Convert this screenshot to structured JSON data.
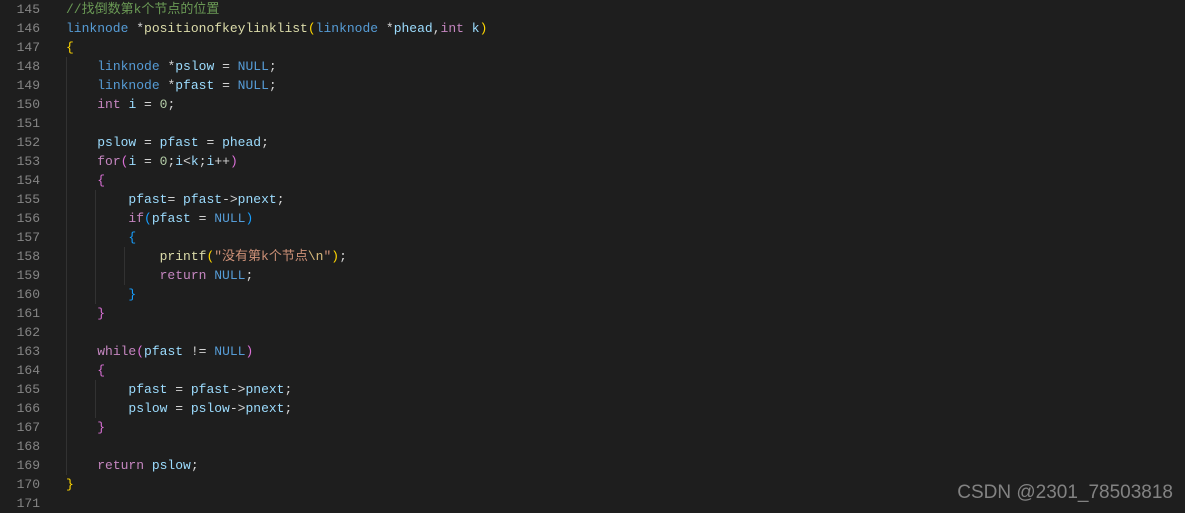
{
  "watermark": "CSDN @2301_78503818",
  "startLine": 145,
  "lines": [
    {
      "n": 145,
      "tokens": [
        {
          "t": "//找倒数第k个节点的位置",
          "c": "tok-comment"
        }
      ]
    },
    {
      "n": 146,
      "tokens": [
        {
          "t": "linknode ",
          "c": "tok-type"
        },
        {
          "t": "*",
          "c": "tok-op"
        },
        {
          "t": "positionofkeylinklist",
          "c": "tok-func"
        },
        {
          "t": "(",
          "c": "tok-brace-yellow"
        },
        {
          "t": "linknode ",
          "c": "tok-type"
        },
        {
          "t": "*",
          "c": "tok-op"
        },
        {
          "t": "phead",
          "c": "tok-param"
        },
        {
          "t": ",",
          "c": "tok-punct"
        },
        {
          "t": "int ",
          "c": "tok-keyword"
        },
        {
          "t": "k",
          "c": "tok-param"
        },
        {
          "t": ")",
          "c": "tok-brace-yellow"
        }
      ]
    },
    {
      "n": 147,
      "tokens": [
        {
          "t": "{",
          "c": "tok-brace-yellow"
        }
      ]
    },
    {
      "n": 148,
      "tokens": [
        {
          "t": "    ",
          "c": ""
        },
        {
          "t": "linknode ",
          "c": "tok-type"
        },
        {
          "t": "*",
          "c": "tok-op"
        },
        {
          "t": "pslow",
          "c": "tok-var"
        },
        {
          "t": " = ",
          "c": "tok-op"
        },
        {
          "t": "NULL",
          "c": "tok-const"
        },
        {
          "t": ";",
          "c": "tok-punct"
        }
      ]
    },
    {
      "n": 149,
      "tokens": [
        {
          "t": "    ",
          "c": ""
        },
        {
          "t": "linknode ",
          "c": "tok-type"
        },
        {
          "t": "*",
          "c": "tok-op"
        },
        {
          "t": "pfast",
          "c": "tok-var"
        },
        {
          "t": " = ",
          "c": "tok-op"
        },
        {
          "t": "NULL",
          "c": "tok-const"
        },
        {
          "t": ";",
          "c": "tok-punct"
        }
      ]
    },
    {
      "n": 150,
      "tokens": [
        {
          "t": "    ",
          "c": ""
        },
        {
          "t": "int ",
          "c": "tok-keyword"
        },
        {
          "t": "i",
          "c": "tok-var"
        },
        {
          "t": " = ",
          "c": "tok-op"
        },
        {
          "t": "0",
          "c": "tok-number"
        },
        {
          "t": ";",
          "c": "tok-punct"
        }
      ]
    },
    {
      "n": 151,
      "tokens": []
    },
    {
      "n": 152,
      "tokens": [
        {
          "t": "    ",
          "c": ""
        },
        {
          "t": "pslow",
          "c": "tok-var"
        },
        {
          "t": " = ",
          "c": "tok-op"
        },
        {
          "t": "pfast",
          "c": "tok-var"
        },
        {
          "t": " = ",
          "c": "tok-op"
        },
        {
          "t": "phead",
          "c": "tok-var"
        },
        {
          "t": ";",
          "c": "tok-punct"
        }
      ]
    },
    {
      "n": 153,
      "tokens": [
        {
          "t": "    ",
          "c": ""
        },
        {
          "t": "for",
          "c": "tok-keyword"
        },
        {
          "t": "(",
          "c": "tok-brace-purple"
        },
        {
          "t": "i",
          "c": "tok-var"
        },
        {
          "t": " = ",
          "c": "tok-op"
        },
        {
          "t": "0",
          "c": "tok-number"
        },
        {
          "t": ";",
          "c": "tok-punct"
        },
        {
          "t": "i",
          "c": "tok-var"
        },
        {
          "t": "<",
          "c": "tok-op"
        },
        {
          "t": "k",
          "c": "tok-var"
        },
        {
          "t": ";",
          "c": "tok-punct"
        },
        {
          "t": "i",
          "c": "tok-var"
        },
        {
          "t": "++",
          "c": "tok-op"
        },
        {
          "t": ")",
          "c": "tok-brace-purple"
        }
      ]
    },
    {
      "n": 154,
      "tokens": [
        {
          "t": "    ",
          "c": ""
        },
        {
          "t": "{",
          "c": "tok-brace-purple"
        }
      ]
    },
    {
      "n": 155,
      "tokens": [
        {
          "t": "        ",
          "c": ""
        },
        {
          "t": "pfast",
          "c": "tok-var"
        },
        {
          "t": "= ",
          "c": "tok-op"
        },
        {
          "t": "pfast",
          "c": "tok-var"
        },
        {
          "t": "->",
          "c": "tok-op"
        },
        {
          "t": "pnext",
          "c": "tok-var"
        },
        {
          "t": ";",
          "c": "tok-punct"
        }
      ]
    },
    {
      "n": 156,
      "tokens": [
        {
          "t": "        ",
          "c": ""
        },
        {
          "t": "if",
          "c": "tok-keyword"
        },
        {
          "t": "(",
          "c": "tok-brace-blue"
        },
        {
          "t": "pfast",
          "c": "tok-var"
        },
        {
          "t": " = ",
          "c": "tok-op"
        },
        {
          "t": "NULL",
          "c": "tok-const"
        },
        {
          "t": ")",
          "c": "tok-brace-blue"
        }
      ]
    },
    {
      "n": 157,
      "tokens": [
        {
          "t": "        ",
          "c": ""
        },
        {
          "t": "{",
          "c": "tok-brace-blue"
        }
      ]
    },
    {
      "n": 158,
      "tokens": [
        {
          "t": "            ",
          "c": ""
        },
        {
          "t": "printf",
          "c": "tok-func"
        },
        {
          "t": "(",
          "c": "tok-brace-yellow"
        },
        {
          "t": "\"没有第k个节点",
          "c": "tok-string"
        },
        {
          "t": "\\n",
          "c": "tok-esc"
        },
        {
          "t": "\"",
          "c": "tok-string"
        },
        {
          "t": ")",
          "c": "tok-brace-yellow"
        },
        {
          "t": ";",
          "c": "tok-punct"
        }
      ]
    },
    {
      "n": 159,
      "tokens": [
        {
          "t": "            ",
          "c": ""
        },
        {
          "t": "return ",
          "c": "tok-keyword"
        },
        {
          "t": "NULL",
          "c": "tok-const"
        },
        {
          "t": ";",
          "c": "tok-punct"
        }
      ]
    },
    {
      "n": 160,
      "tokens": [
        {
          "t": "        ",
          "c": ""
        },
        {
          "t": "}",
          "c": "tok-brace-blue"
        }
      ]
    },
    {
      "n": 161,
      "tokens": [
        {
          "t": "    ",
          "c": ""
        },
        {
          "t": "}",
          "c": "tok-brace-purple"
        }
      ]
    },
    {
      "n": 162,
      "tokens": []
    },
    {
      "n": 163,
      "tokens": [
        {
          "t": "    ",
          "c": ""
        },
        {
          "t": "while",
          "c": "tok-keyword"
        },
        {
          "t": "(",
          "c": "tok-brace-purple"
        },
        {
          "t": "pfast",
          "c": "tok-var"
        },
        {
          "t": " != ",
          "c": "tok-op"
        },
        {
          "t": "NULL",
          "c": "tok-const"
        },
        {
          "t": ")",
          "c": "tok-brace-purple"
        }
      ]
    },
    {
      "n": 164,
      "tokens": [
        {
          "t": "    ",
          "c": ""
        },
        {
          "t": "{",
          "c": "tok-brace-purple"
        }
      ]
    },
    {
      "n": 165,
      "tokens": [
        {
          "t": "        ",
          "c": ""
        },
        {
          "t": "pfast",
          "c": "tok-var"
        },
        {
          "t": " = ",
          "c": "tok-op"
        },
        {
          "t": "pfast",
          "c": "tok-var"
        },
        {
          "t": "->",
          "c": "tok-op"
        },
        {
          "t": "pnext",
          "c": "tok-var"
        },
        {
          "t": ";",
          "c": "tok-punct"
        }
      ]
    },
    {
      "n": 166,
      "tokens": [
        {
          "t": "        ",
          "c": ""
        },
        {
          "t": "pslow",
          "c": "tok-var"
        },
        {
          "t": " = ",
          "c": "tok-op"
        },
        {
          "t": "pslow",
          "c": "tok-var"
        },
        {
          "t": "->",
          "c": "tok-op"
        },
        {
          "t": "pnext",
          "c": "tok-var"
        },
        {
          "t": ";",
          "c": "tok-punct"
        }
      ]
    },
    {
      "n": 167,
      "tokens": [
        {
          "t": "    ",
          "c": ""
        },
        {
          "t": "}",
          "c": "tok-brace-purple"
        }
      ]
    },
    {
      "n": 168,
      "tokens": []
    },
    {
      "n": 169,
      "tokens": [
        {
          "t": "    ",
          "c": ""
        },
        {
          "t": "return ",
          "c": "tok-keyword"
        },
        {
          "t": "pslow",
          "c": "tok-var"
        },
        {
          "t": ";",
          "c": "tok-punct"
        }
      ]
    },
    {
      "n": 170,
      "tokens": [
        {
          "t": "}",
          "c": "tok-brace-yellow"
        }
      ]
    },
    {
      "n": 171,
      "tokens": []
    }
  ]
}
